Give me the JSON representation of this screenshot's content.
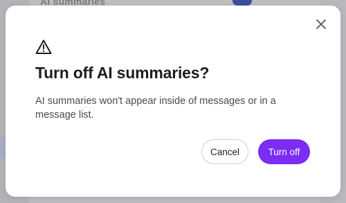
{
  "background": {
    "header_text": "AI summaries",
    "toggle_state": "on"
  },
  "dialog": {
    "title": "Turn off AI summaries?",
    "body": "AI summaries won't appear inside of messages or in a message list.",
    "cancel_label": "Cancel",
    "confirm_label": "Turn off",
    "icons": {
      "warning": "warning-icon",
      "close": "close-icon"
    }
  },
  "colors": {
    "primary": "#7b2cf5",
    "backdrop": "#b8b9bd",
    "dialog_bg": "#ffffff",
    "title": "#1d1d1f",
    "body_text": "#4a4b4f"
  }
}
